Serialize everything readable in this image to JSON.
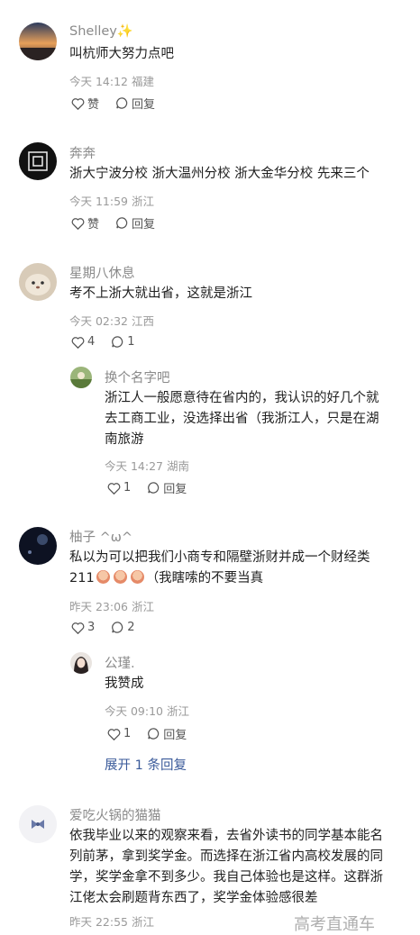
{
  "comments": [
    {
      "user": "Shelley",
      "user_badge": "sparkle-icon",
      "text": "叫杭师大努力点吧",
      "time": "今天 14:12",
      "location": "福建",
      "like_label": "赞",
      "reply_label": "回复"
    },
    {
      "user": "奔奔",
      "text": "浙大宁波分校 浙大温州分校 浙大金华分校 先来三个",
      "time": "今天 11:59",
      "location": "浙江",
      "like_label": "赞",
      "reply_label": "回复"
    },
    {
      "user": "星期八休息",
      "text": "考不上浙大就出省，这就是浙江",
      "time": "今天 02:32",
      "location": "江西",
      "likes": "4",
      "replies": "1",
      "reply": {
        "user": "换个名字吧",
        "text_lines": [
          "浙江人一般愿意待在省内的，我认识的好几个就",
          "去工商工业，没选择出省（我浙江人，只是在湖",
          "南旅游"
        ],
        "time": "今天 14:27",
        "location": "湖南",
        "likes": "1",
        "reply_label": "回复"
      }
    },
    {
      "user": "柚子 ^ω^",
      "text_line1": "私以为可以把我们小商专和隔壁浙财并成一个财经类",
      "text_line2_prefix": "211",
      "text_line2_suffix": "（我瞎嗦的不要当真",
      "time": "昨天 23:06",
      "location": "浙江",
      "likes": "3",
      "replies": "2",
      "reply": {
        "user": "公瑾.",
        "text": "我赞成",
        "time": "今天 09:10",
        "location": "浙江",
        "likes": "1",
        "reply_label": "回复"
      },
      "expand_label": "展开 1 条回复"
    },
    {
      "user": "爱吃火锅的猫猫",
      "text_lines": [
        "依我毕业以来的观察来看，去省外读书的同学基本能名",
        "列前茅，拿到奖学金。而选择在浙江省内高校发展的同",
        "学，奖学金拿不到多少。我自己体验也是这样。这群浙",
        "江佬太会刷题背东西了，奖学金体验感很差"
      ],
      "time": "昨天 22:55",
      "location": "浙江"
    }
  ],
  "watermark": "高考直通车"
}
